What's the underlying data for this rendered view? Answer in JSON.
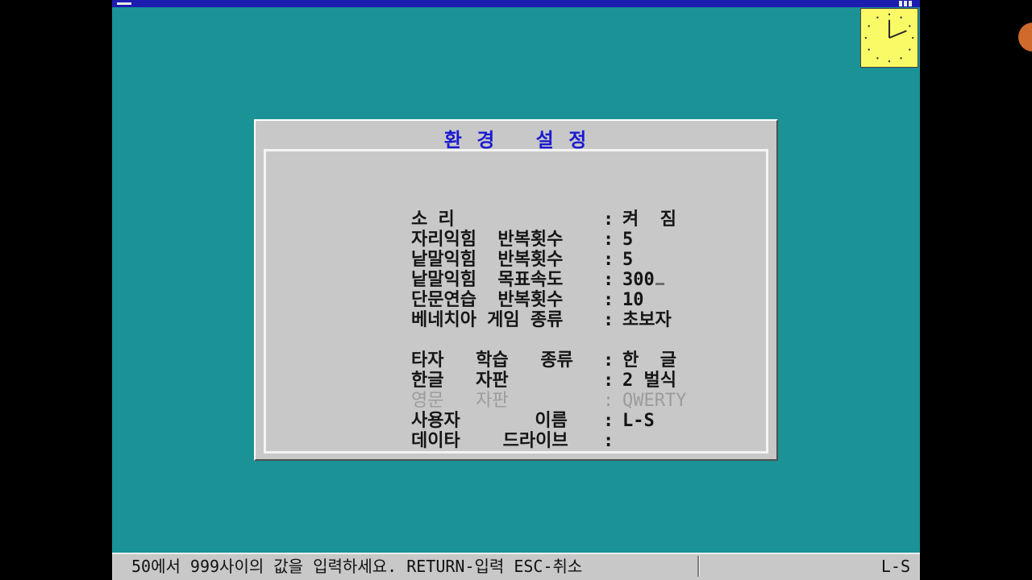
{
  "dialog": {
    "title": "환 경   설 정",
    "rows": [
      {
        "label": "소 리",
        "sep": ":",
        "value": "켜  짐"
      },
      {
        "label": "자리익힘  반복횟수",
        "sep": ":",
        "value": "5"
      },
      {
        "label": "낱말익힘  반복횟수",
        "sep": ":",
        "value": "5"
      },
      {
        "label": "낱말익힘  목표속도",
        "sep": ":",
        "value": "300"
      },
      {
        "label": "단문연습  반복횟수",
        "sep": ":",
        "value": "10"
      },
      {
        "label": "베네치아 게임 종류",
        "sep": ":",
        "value": "초보자"
      },
      {
        "label": "타자   학습   종류",
        "sep": ":",
        "value": "한  글"
      },
      {
        "label": "한글   자판",
        "sep": ":",
        "value": "2 벌식"
      },
      {
        "label": "영문   자판",
        "sep": ":",
        "value": "QWERTY"
      },
      {
        "label": "사용자       이름",
        "sep": ":",
        "value": "L-S"
      },
      {
        "label": "데이타    드라이브",
        "sep": ":",
        "value": ""
      }
    ]
  },
  "status": {
    "message": "50에서 999사이의 값을 입력하세요. RETURN-입력 ESC-취소",
    "user": "L-S"
  },
  "icons": {
    "clock": "clock-icon"
  },
  "colors": {
    "desktop": "#1a9296",
    "title_bar": "#1c1cb0",
    "dialog_title": "#1a1ad0",
    "dialog_bg": "#c8c8c8",
    "clock_bg": "#fafa66"
  }
}
